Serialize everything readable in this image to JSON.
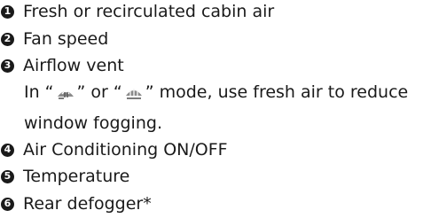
{
  "items": [
    {
      "num": "1",
      "label": "Fresh or recirculated cabin air"
    },
    {
      "num": "2",
      "label": "Fan speed"
    },
    {
      "num": "3",
      "label": "Airflow vent"
    },
    {
      "num": "4",
      "label": "Air Conditioning ON/OFF"
    },
    {
      "num": "5",
      "label": "Temperature"
    },
    {
      "num": "6",
      "label": "Rear defogger*"
    }
  ],
  "note": {
    "part1": "In “",
    "part2": "” or “",
    "part3": "” mode, use fresh air to reduce window fogging.",
    "icon1": "windshield-defrost-floor-icon",
    "icon2": "windshield-defrost-icon"
  }
}
